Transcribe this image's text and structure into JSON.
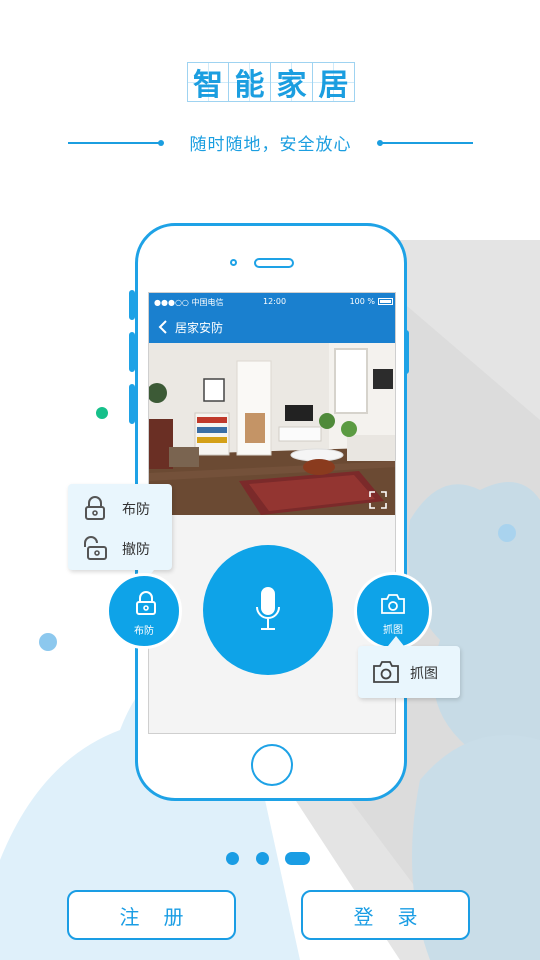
{
  "header": {
    "title_chars": [
      "智",
      "能",
      "家",
      "居"
    ],
    "subtitle": "随时随地，安全放心"
  },
  "phone": {
    "status": {
      "carrier": "●●●○○ 中国电信",
      "time": "12:00",
      "battery": "100 %"
    },
    "nav_title": "居家安防"
  },
  "arm_menu": {
    "items": [
      {
        "label": "布防",
        "icon": "lock-closed-icon"
      },
      {
        "label": "撤防",
        "icon": "lock-open-icon"
      }
    ]
  },
  "arm_button": {
    "label": "布防",
    "icon": "lock-icon"
  },
  "mic_button": {
    "icon": "microphone-icon"
  },
  "snapshot_button": {
    "label": "抓图",
    "icon": "camera-icon"
  },
  "snapshot_popup": {
    "label": "抓图",
    "icon": "camera-icon"
  },
  "pager": {
    "count": 3,
    "active_index": 2
  },
  "buttons": {
    "register": "注册",
    "login": "登录"
  },
  "colors": {
    "accent": "#1a9de4",
    "bubble": "#e9f6fd",
    "statusbar": "#1a80cf"
  }
}
